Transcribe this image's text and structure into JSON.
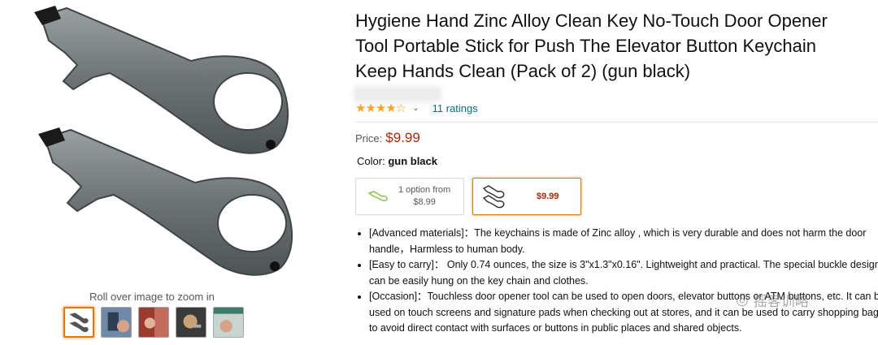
{
  "gallery": {
    "zoom_hint": "Roll over image to zoom in",
    "thumbnails": [
      "key-openers",
      "using-on-phone",
      "opening-door",
      "on-keys",
      "pressing-button"
    ]
  },
  "product": {
    "title": "Hygiene Hand Zinc Alloy Clean Key No-Touch Door Opener Tool Portable Stick for Push The Elevator Button Keychain Keep Hands Clean (Pack of 2) (gun black)",
    "rating_stars": 4.5,
    "rating_text": "★★★★☆",
    "ratings_count": "11 ratings",
    "price_label": "Price:",
    "price": "$9.99",
    "color_label": "Color:",
    "color_value": "gun black",
    "options": [
      {
        "line1": "1 option from",
        "line2": "$8.99"
      },
      {
        "price": "$9.99"
      }
    ],
    "bullets": [
      "[Advanced materials]：The keychains is made of Zinc alloy , which is very durable and does not harm the door handle，Harmless to human body.",
      "[Easy to carry]： Only 0.74 ounces, the size is 3\"x1.3\"x0.16\". Lightweight and practical. The special buckle design can be easily hung on the key chain and clothes.",
      "[Occasion]：Touchless door opener tool can be used to open doors, elevator buttons or ATM buttons, etc. It can be used on touch screens and signature pads when checking out at stores, and it can be used to carry shopping bags to avoid direct contact with surfaces or buttons in public places and shared objects."
    ]
  },
  "watermark": "摇客训略",
  "colors": {
    "accent": "#e77600",
    "price": "#b12704",
    "link": "#007185",
    "star": "#ffa41c"
  }
}
